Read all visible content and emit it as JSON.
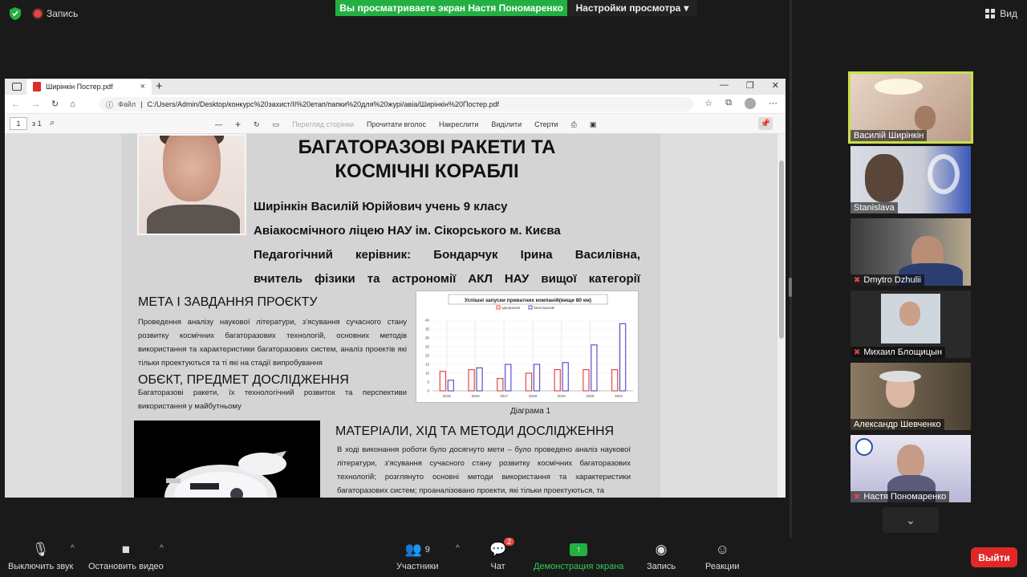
{
  "top": {
    "record_label": "Запись",
    "share_banner": "Вы просматриваете экран Настя Пономаренко",
    "view_settings": "Настройки просмотра",
    "view_label": "Вид"
  },
  "browser": {
    "tab_title": "Ширінкін Постер.pdf",
    "url_label": "Файл",
    "url": "C:/Users/Admin/Desktop/конкурс%20захист/ІІ%20етап/папки%20для%20журі/авіа/Ширінкін%20Постер.pdf",
    "page_number": "1",
    "page_total": "з 1",
    "tools": {
      "page_view": "Перегляд сторінки",
      "read_aloud": "Прочитати вголос",
      "draw": "Накреслити",
      "highlight": "Виділити",
      "erase": "Стерти"
    }
  },
  "poster": {
    "title_line1": "БАГАТОРАЗОВІ РАКЕТИ ТА",
    "title_line2": "КОСМІЧНІ КОРАБЛІ",
    "author_line1": "Ширінкін Василій Юрійович учень 9 класу",
    "author_line2": "Авіакосмічного ліцею НАУ ім. Сікорського м. Києва",
    "author_line3": "Педагогічний керівник: Бондарчук Ірина Василівна,",
    "author_line4": "вчитель фізики та астрономії АКЛ НАУ вищої категорії",
    "s1_heading": "МЕТА І ЗАВДАННЯ ПРОЄКТУ",
    "s1_text": "Проведення аналізу наукової літератури, з'ясування сучасного стану розвитку космічних багаторазових технологій, основних методів використання та характеристики багаторазових систем, аналіз проектів які тільки проектуються та ті які на стадії випробування",
    "s2_heading": "ОБЄКТ, ПРЕДМЕТ ДОСЛІДЖЕННЯ",
    "s2_text": "Багаторазові ракети, їх технологічний розвиток та перспективи використання у майбутньому",
    "s3_heading": "МАТЕРІАЛИ, ХІД ТА МЕТОДИ ДОСЛІДЖЕННЯ",
    "s3_text": "В ході виконання роботи було досягнуто мети – було проведено аналіз наукової літератури, з'ясування сучасного стану розвитку космічних багаторазових технологій; розглянуто основні методи використання та характеристики багаторазових систем; проаналізовано проекти, які тільки проектуються, та",
    "chart_caption": "Діаграма 1"
  },
  "chart_data": {
    "type": "bar",
    "title": "Успішні запуски приватних компаній(вище 80 км)",
    "categories": [
      "2015",
      "2016",
      "2017",
      "2018",
      "2019",
      "2020",
      "2021"
    ],
    "series": [
      {
        "name": "одноразові",
        "values": [
          11,
          12,
          7,
          10,
          12,
          12,
          12
        ]
      },
      {
        "name": "багаторазові",
        "values": [
          6,
          13,
          15,
          15,
          16,
          26,
          38
        ]
      }
    ],
    "yticks": [
      0,
      5,
      10,
      15,
      20,
      25,
      30,
      35,
      40
    ],
    "ylim": [
      0,
      40
    ],
    "colors": {
      "одноразові": "#e8484a",
      "багаторазові": "#5a55d6"
    },
    "legend": "top"
  },
  "gallery": [
    {
      "name": "Василій Ширінкін",
      "muted": false,
      "active": true
    },
    {
      "name": "Stanislava",
      "muted": false,
      "active": false
    },
    {
      "name": "Dmytro Dzhulii",
      "muted": true,
      "active": false
    },
    {
      "name": "Михаил Блощицын",
      "muted": true,
      "active": false
    },
    {
      "name": "Александр Шевченко",
      "muted": false,
      "active": false
    },
    {
      "name": "Настя Пономаренко",
      "muted": true,
      "active": false
    }
  ],
  "bottom": {
    "mute_label": "Выключить звук",
    "video_label": "Остановить видео",
    "participants_count": "9",
    "participants_label": "Участники",
    "chat_badge": "2",
    "chat_label": "Чат",
    "share_label": "Демонстрация экрана",
    "record_label": "Запись",
    "reactions_label": "Реакции",
    "leave_label": "Выйти"
  }
}
